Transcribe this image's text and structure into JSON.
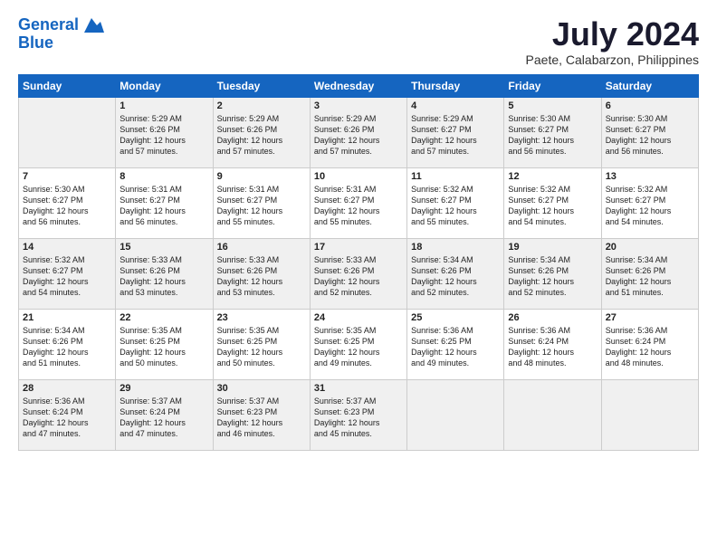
{
  "logo": {
    "line1": "General",
    "line2": "Blue"
  },
  "title": "July 2024",
  "location": "Paete, Calabarzon, Philippines",
  "days_of_week": [
    "Sunday",
    "Monday",
    "Tuesday",
    "Wednesday",
    "Thursday",
    "Friday",
    "Saturday"
  ],
  "weeks": [
    [
      {
        "day": "",
        "info": ""
      },
      {
        "day": "1",
        "info": "Sunrise: 5:29 AM\nSunset: 6:26 PM\nDaylight: 12 hours\nand 57 minutes."
      },
      {
        "day": "2",
        "info": "Sunrise: 5:29 AM\nSunset: 6:26 PM\nDaylight: 12 hours\nand 57 minutes."
      },
      {
        "day": "3",
        "info": "Sunrise: 5:29 AM\nSunset: 6:26 PM\nDaylight: 12 hours\nand 57 minutes."
      },
      {
        "day": "4",
        "info": "Sunrise: 5:29 AM\nSunset: 6:27 PM\nDaylight: 12 hours\nand 57 minutes."
      },
      {
        "day": "5",
        "info": "Sunrise: 5:30 AM\nSunset: 6:27 PM\nDaylight: 12 hours\nand 56 minutes."
      },
      {
        "day": "6",
        "info": "Sunrise: 5:30 AM\nSunset: 6:27 PM\nDaylight: 12 hours\nand 56 minutes."
      }
    ],
    [
      {
        "day": "7",
        "info": ""
      },
      {
        "day": "8",
        "info": "Sunrise: 5:31 AM\nSunset: 6:27 PM\nDaylight: 12 hours\nand 56 minutes."
      },
      {
        "day": "9",
        "info": "Sunrise: 5:31 AM\nSunset: 6:27 PM\nDaylight: 12 hours\nand 55 minutes."
      },
      {
        "day": "10",
        "info": "Sunrise: 5:31 AM\nSunset: 6:27 PM\nDaylight: 12 hours\nand 55 minutes."
      },
      {
        "day": "11",
        "info": "Sunrise: 5:32 AM\nSunset: 6:27 PM\nDaylight: 12 hours\nand 55 minutes."
      },
      {
        "day": "12",
        "info": "Sunrise: 5:32 AM\nSunset: 6:27 PM\nDaylight: 12 hours\nand 54 minutes."
      },
      {
        "day": "13",
        "info": "Sunrise: 5:32 AM\nSunset: 6:27 PM\nDaylight: 12 hours\nand 54 minutes."
      }
    ],
    [
      {
        "day": "14",
        "info": ""
      },
      {
        "day": "15",
        "info": "Sunrise: 5:33 AM\nSunset: 6:26 PM\nDaylight: 12 hours\nand 53 minutes."
      },
      {
        "day": "16",
        "info": "Sunrise: 5:33 AM\nSunset: 6:26 PM\nDaylight: 12 hours\nand 53 minutes."
      },
      {
        "day": "17",
        "info": "Sunrise: 5:33 AM\nSunset: 6:26 PM\nDaylight: 12 hours\nand 52 minutes."
      },
      {
        "day": "18",
        "info": "Sunrise: 5:34 AM\nSunset: 6:26 PM\nDaylight: 12 hours\nand 52 minutes."
      },
      {
        "day": "19",
        "info": "Sunrise: 5:34 AM\nSunset: 6:26 PM\nDaylight: 12 hours\nand 52 minutes."
      },
      {
        "day": "20",
        "info": "Sunrise: 5:34 AM\nSunset: 6:26 PM\nDaylight: 12 hours\nand 51 minutes."
      }
    ],
    [
      {
        "day": "21",
        "info": ""
      },
      {
        "day": "22",
        "info": "Sunrise: 5:35 AM\nSunset: 6:25 PM\nDaylight: 12 hours\nand 50 minutes."
      },
      {
        "day": "23",
        "info": "Sunrise: 5:35 AM\nSunset: 6:25 PM\nDaylight: 12 hours\nand 50 minutes."
      },
      {
        "day": "24",
        "info": "Sunrise: 5:35 AM\nSunset: 6:25 PM\nDaylight: 12 hours\nand 49 minutes."
      },
      {
        "day": "25",
        "info": "Sunrise: 5:36 AM\nSunset: 6:25 PM\nDaylight: 12 hours\nand 49 minutes."
      },
      {
        "day": "26",
        "info": "Sunrise: 5:36 AM\nSunset: 6:24 PM\nDaylight: 12 hours\nand 48 minutes."
      },
      {
        "day": "27",
        "info": "Sunrise: 5:36 AM\nSunset: 6:24 PM\nDaylight: 12 hours\nand 48 minutes."
      }
    ],
    [
      {
        "day": "28",
        "info": "Sunrise: 5:36 AM\nSunset: 6:24 PM\nDaylight: 12 hours\nand 47 minutes."
      },
      {
        "day": "29",
        "info": "Sunrise: 5:37 AM\nSunset: 6:24 PM\nDaylight: 12 hours\nand 47 minutes."
      },
      {
        "day": "30",
        "info": "Sunrise: 5:37 AM\nSunset: 6:23 PM\nDaylight: 12 hours\nand 46 minutes."
      },
      {
        "day": "31",
        "info": "Sunrise: 5:37 AM\nSunset: 6:23 PM\nDaylight: 12 hours\nand 45 minutes."
      },
      {
        "day": "",
        "info": ""
      },
      {
        "day": "",
        "info": ""
      },
      {
        "day": "",
        "info": ""
      }
    ]
  ],
  "week1_sun_info": "Sunrise: 5:30 AM\nSunset: 6:27 PM\nDaylight: 12 hours\nand 56 minutes.",
  "week2_sun_info": "Sunrise: 5:30 AM\nSunset: 6:27 PM\nDaylight: 12 hours\nand 56 minutes.",
  "week3_sun_info": "Sunrise: 5:32 AM\nSunset: 6:27 PM\nDaylight: 12 hours\nand 54 minutes.",
  "week4_sun_info": "Sunrise: 5:34 AM\nSunset: 6:26 PM\nDaylight: 12 hours\nand 51 minutes."
}
